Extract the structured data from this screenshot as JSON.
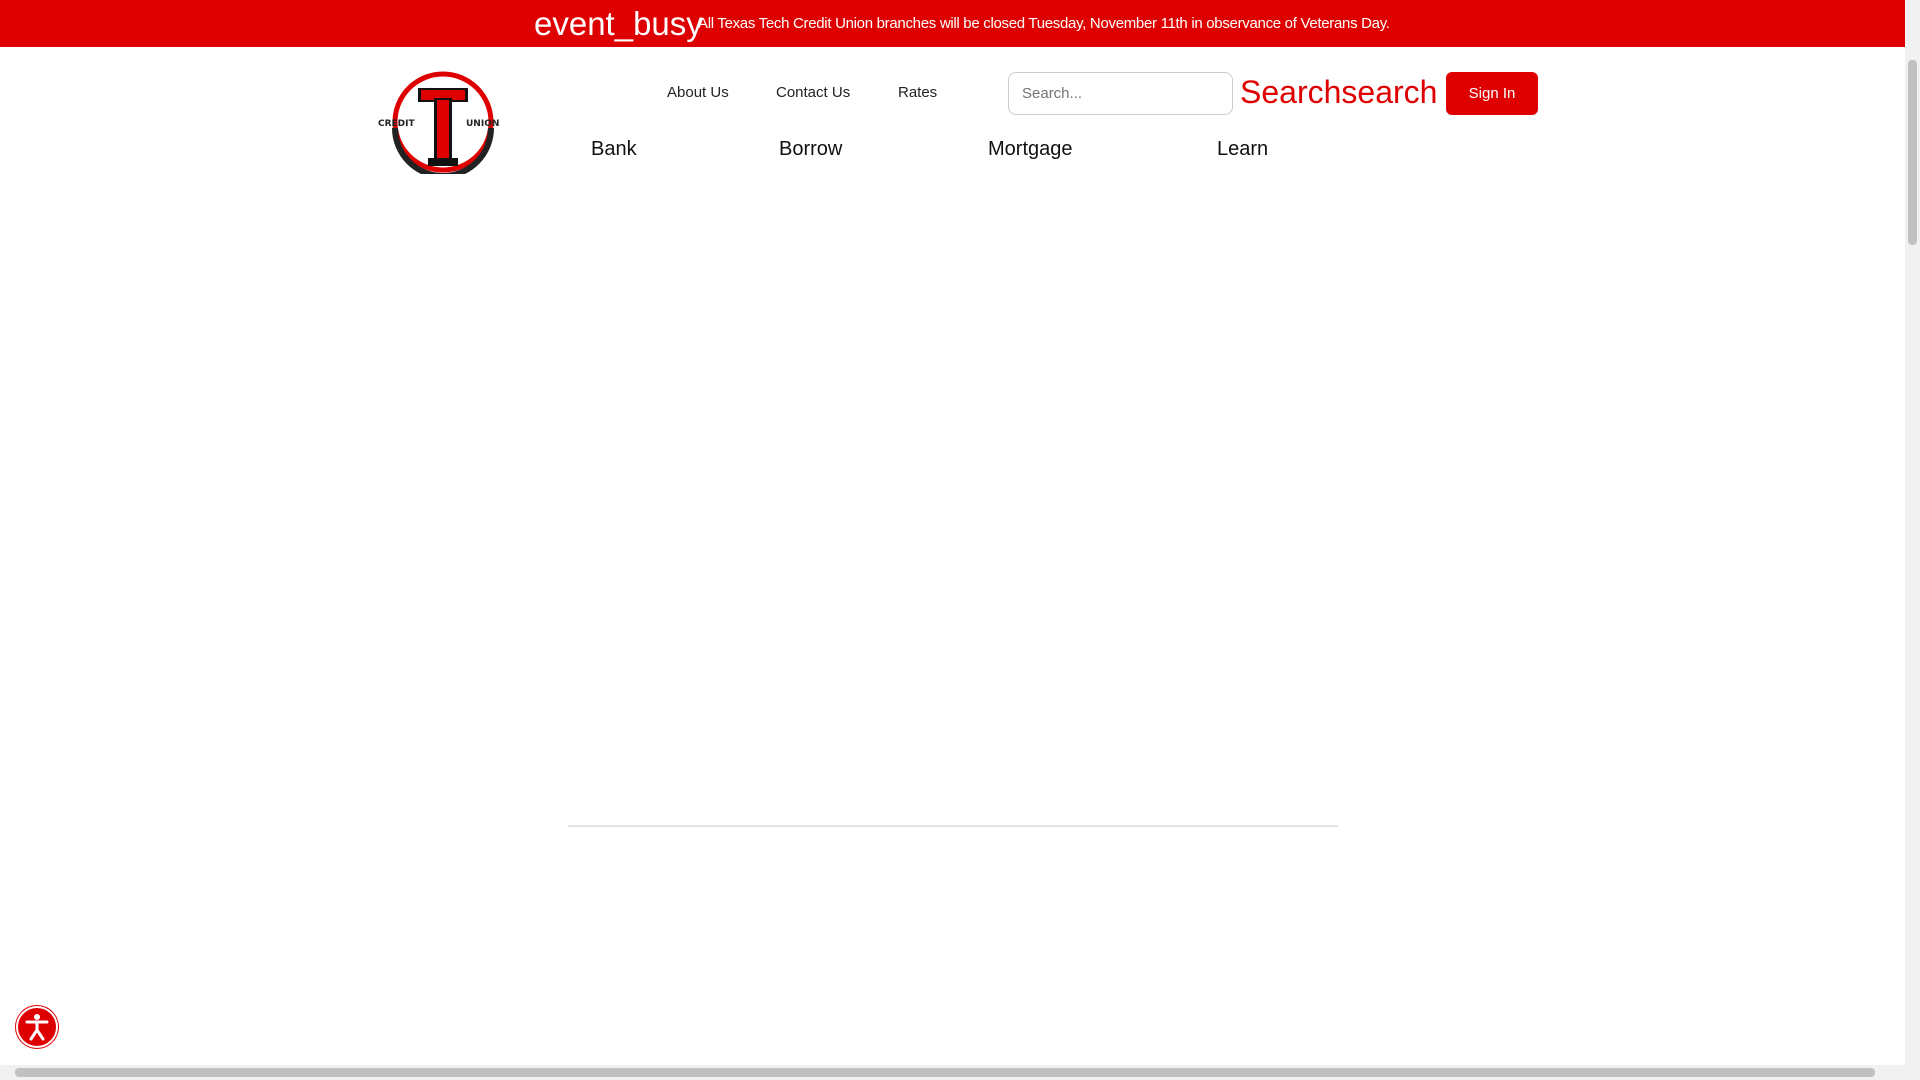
{
  "banner": {
    "icon": "event_busy",
    "message": "All Texas Tech Credit Union branches will be closed Tuesday, November 11th in observance of Veterans Day."
  },
  "logo": {
    "text_left": "CREDIT",
    "text_right": "UNION"
  },
  "utility_nav": [
    {
      "label": "About Us"
    },
    {
      "label": "Contact Us"
    },
    {
      "label": "Rates"
    }
  ],
  "search": {
    "placeholder": "Search...",
    "button_label": "Searchsearch"
  },
  "sign_in": "Sign In",
  "main_nav": [
    {
      "label": "Bank"
    },
    {
      "label": "Borrow"
    },
    {
      "label": "Mortgage"
    },
    {
      "label": "Learn"
    }
  ],
  "colors": {
    "brand": "#de0000"
  }
}
